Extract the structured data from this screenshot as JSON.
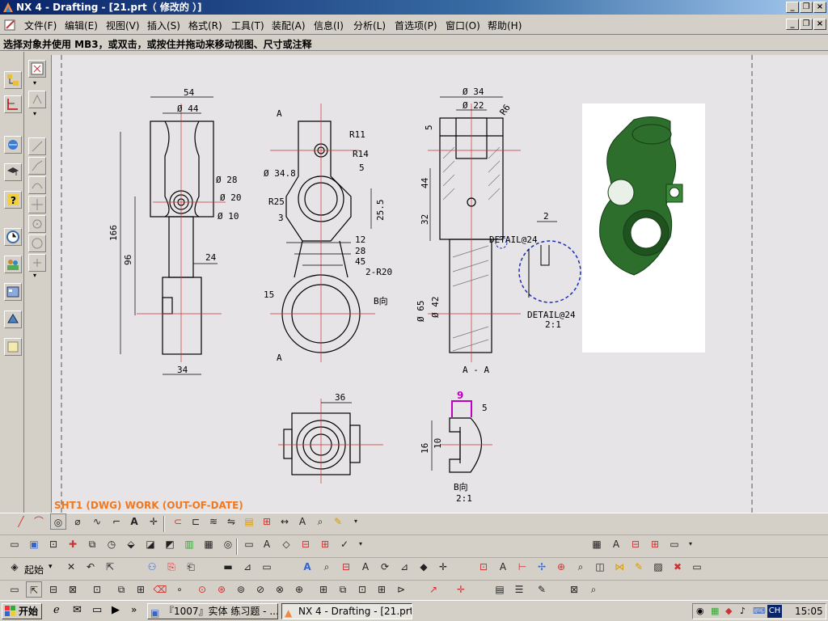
{
  "window": {
    "title": "NX 4 - Drafting - [21.prt（ 修改的 ）]"
  },
  "menu": [
    "文件(F)",
    "编辑(E)",
    "视图(V)",
    "插入(S)",
    "格式(R)",
    "工具(T)",
    "装配(A)",
    "信息(I)",
    "分析(L)",
    "首选项(P)",
    "窗口(O)",
    "帮助(H)"
  ],
  "status": {
    "prompt": "选择对象并使用 MB3，或双击，或按住并拖动来移动视图、尺寸或注释"
  },
  "sheet": {
    "label": "SHT1 (DWG) WORK (OUT-OF-DATE)"
  },
  "drawing": {
    "view1": {
      "d54": "54",
      "d44": "Ø 44",
      "d28": "Ø 28",
      "d20": "Ø 20",
      "d10": "Ø 10",
      "d166": "166",
      "d96": "96",
      "d24": "24",
      "d34": "34"
    },
    "view2": {
      "a_top": "A",
      "a_bottom": "A",
      "r11": "R11",
      "r14": "R14",
      "d5": "5",
      "d348": "Ø 34.8",
      "r25": "R25",
      "d3": "3",
      "d255": "25.5",
      "d12": "12",
      "d28": "28",
      "d45": "45",
      "r20": "2-R20",
      "d15": "15",
      "bdir": "B向"
    },
    "view3": {
      "d34": "Ø 34",
      "d22": "Ø 22",
      "r6": "R6",
      "d5": "5",
      "d44": "44",
      "d32": "32",
      "d65": "Ø 65",
      "d42": "Ø 42",
      "title": "A - A"
    },
    "detail": {
      "d2": "2",
      "label1": "DETAIL@24",
      "label2": "DETAIL@24",
      "scale": "2:1"
    },
    "view4": {
      "d36": "36"
    },
    "view5": {
      "d9": "9",
      "d5": "5",
      "d16": "16",
      "d10": "10",
      "title": "B向",
      "scale": "2:1"
    }
  },
  "toolbar": {
    "start_label": "起始",
    "start_dropdown": "▾"
  },
  "taskbar": {
    "start": "开始",
    "tasks": [
      "『1007』实体 练习题 - ...",
      "NX 4 - Drafting - [21.prt ..."
    ],
    "tray_lang": "CH",
    "clock": "15:05"
  },
  "colors": {
    "model_green": "#2d6e2d",
    "detail_circle": "#1a2fb4",
    "dim_magenta": "#c000c0",
    "work_orange": "#f07820"
  }
}
